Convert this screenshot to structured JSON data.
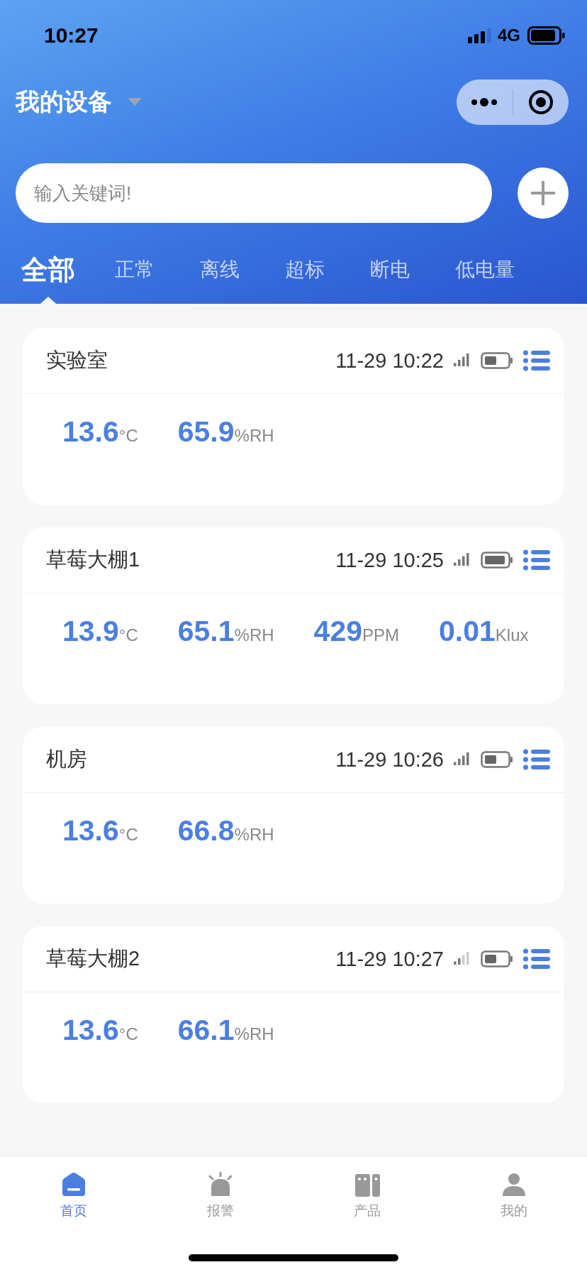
{
  "status_bar": {
    "time": "10:27",
    "network": "4G"
  },
  "header": {
    "title": "我的设备"
  },
  "search": {
    "placeholder": "输入关键词!"
  },
  "tabs": [
    {
      "label": "全部",
      "selected": true
    },
    {
      "label": "正常",
      "selected": false
    },
    {
      "label": "离线",
      "selected": false
    },
    {
      "label": "超标",
      "selected": false
    },
    {
      "label": "断电",
      "selected": false
    },
    {
      "label": "低电量",
      "selected": false
    }
  ],
  "devices": [
    {
      "name": "实验室",
      "time": "11-29 10:22",
      "weak_signal": false,
      "battery_full": false,
      "readings": [
        {
          "value": "13.6",
          "unit": "°C"
        },
        {
          "value": "65.9",
          "unit": "%RH"
        }
      ]
    },
    {
      "name": "草莓大棚1",
      "time": "11-29 10:25",
      "weak_signal": false,
      "battery_full": true,
      "readings": [
        {
          "value": "13.9",
          "unit": "°C"
        },
        {
          "value": "65.1",
          "unit": "%RH"
        },
        {
          "value": "429",
          "unit": "PPM"
        },
        {
          "value": "0.01",
          "unit": "Klux"
        }
      ]
    },
    {
      "name": "机房",
      "time": "11-29 10:26",
      "weak_signal": false,
      "battery_full": false,
      "readings": [
        {
          "value": "13.6",
          "unit": "°C"
        },
        {
          "value": "66.8",
          "unit": "%RH"
        }
      ]
    },
    {
      "name": "草莓大棚2",
      "time": "11-29 10:27",
      "weak_signal": true,
      "battery_full": false,
      "readings": [
        {
          "value": "13.6",
          "unit": "°C"
        },
        {
          "value": "66.1",
          "unit": "%RH"
        }
      ]
    }
  ],
  "nav": [
    {
      "kind": "home",
      "label": "首页",
      "selected": true
    },
    {
      "kind": "alarm",
      "label": "报警",
      "selected": false
    },
    {
      "kind": "product",
      "label": "产品",
      "selected": false
    },
    {
      "kind": "profile",
      "label": "我的",
      "selected": false
    }
  ]
}
